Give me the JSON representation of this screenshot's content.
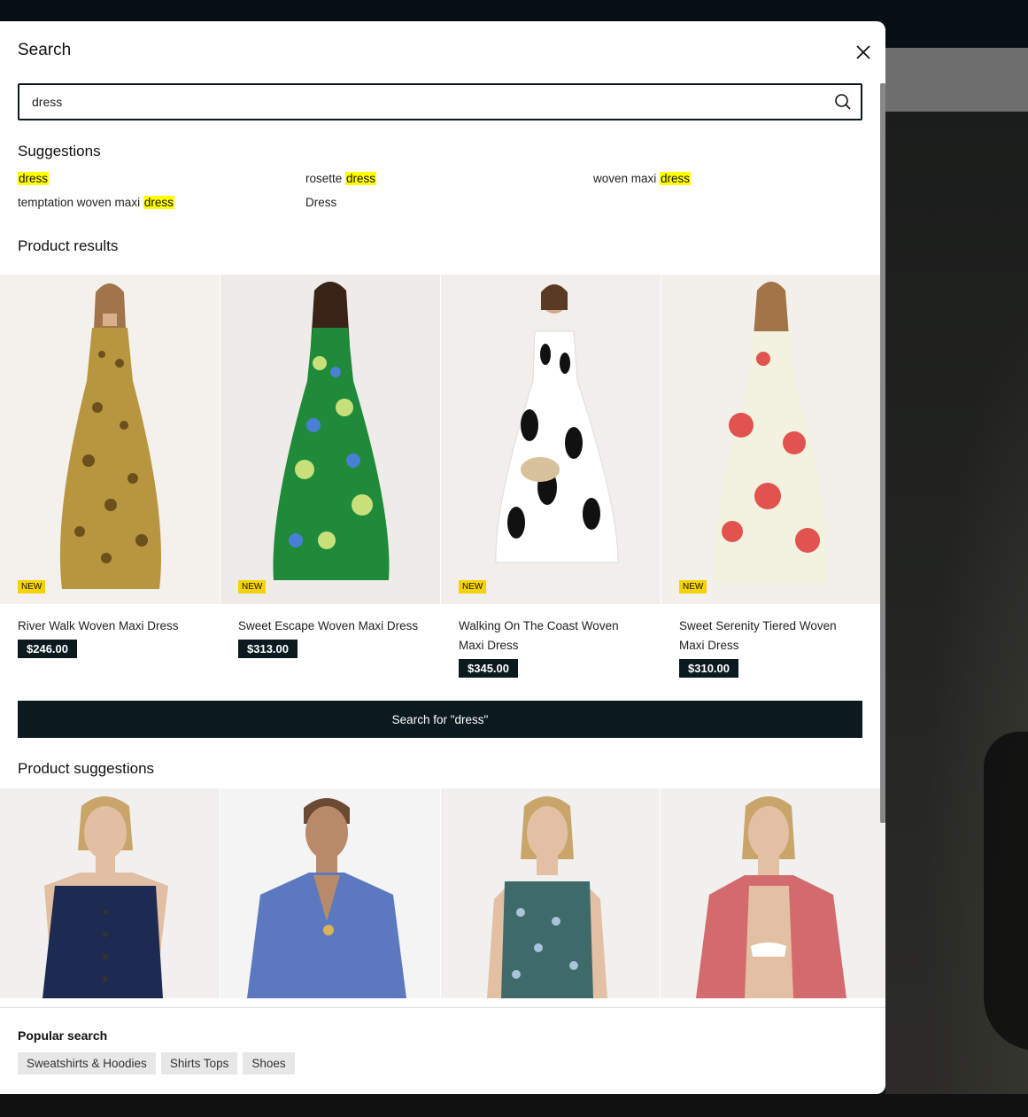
{
  "search": {
    "title": "Search",
    "query": "dress",
    "placeholder": ""
  },
  "suggestions": {
    "title": "Suggestions",
    "items": [
      {
        "prefix": "",
        "match": "dress"
      },
      {
        "prefix": "rosette ",
        "match": "dress"
      },
      {
        "prefix": "woven maxi ",
        "match": "dress"
      },
      {
        "prefix": "temptation woven maxi ",
        "match": "dress"
      },
      {
        "prefix": "Dress",
        "match": ""
      }
    ]
  },
  "product_results": {
    "title": "Product results",
    "badge": "NEW",
    "items": [
      {
        "name": "River Walk Woven Maxi Dress",
        "price": "$246.00"
      },
      {
        "name": "Sweet Escape Woven Maxi Dress",
        "price": "$313.00"
      },
      {
        "name": "Walking On The Coast Woven Maxi Dress",
        "price": "$345.00"
      },
      {
        "name": "Sweet Serenity Tiered Woven Maxi Dress",
        "price": "$310.00"
      }
    ]
  },
  "search_for_button": "Search for \"dress\"",
  "product_suggestions": {
    "title": "Product suggestions"
  },
  "popular_search": {
    "title": "Popular search",
    "tags": [
      "Sweatshirts & Hoodies",
      "Shirts Tops",
      "Shoes"
    ]
  },
  "icons": {
    "close": "close-icon",
    "search": "search-icon"
  },
  "colors": {
    "dark_accent": "#0b1a1f",
    "highlight": "#ffff00",
    "badge": "#f6d300"
  }
}
